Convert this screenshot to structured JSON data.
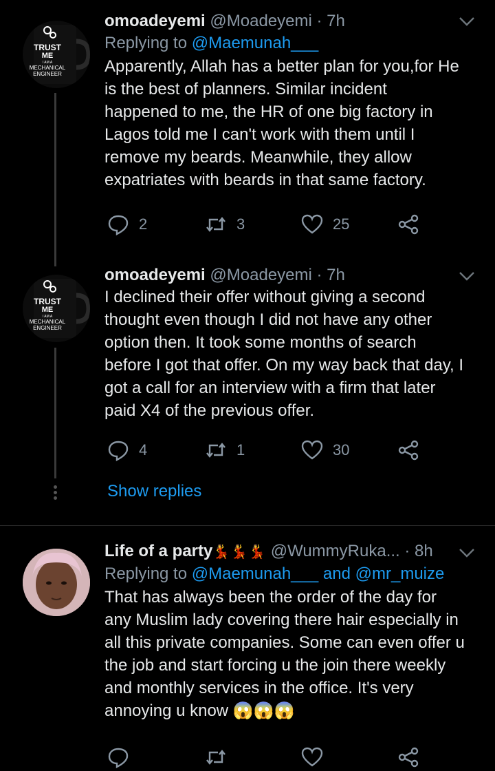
{
  "tweets": [
    {
      "display_name": "omoadeyemi",
      "handle": "@Moadeyemi",
      "time": "· 7h",
      "replying_prefix": "Replying to ",
      "replying_to": "@Maemunah___",
      "text": "Apparently, Allah has a better plan for you,for He\nis the best of planners. Similar incident\nhappened to me, the HR of one big factory in\nLagos told me I can't work with them until I\nremove my beards. Meanwhile, they allow\nexpatriates with beards in that same factory.",
      "replies": "2",
      "retweets": "3",
      "likes": "25",
      "avatar": {
        "line1": "TRUST",
        "line2": "ME",
        "line3": "I AM A",
        "line4": "MECHANICAL",
        "line5": "ENGINEER"
      }
    },
    {
      "display_name": "omoadeyemi",
      "handle": "@Moadeyemi",
      "time": "· 7h",
      "text": "I declined their offer without giving a second\nthought even though I did not have any other\noption then. It took some months of search\nbefore I got that offer. On my way back that day, I\ngot a call for an interview with a firm that later\npaid X4 of the previous offer.",
      "replies": "4",
      "retweets": "1",
      "likes": "30",
      "avatar": {
        "line1": "TRUST",
        "line2": "ME",
        "line3": "I AM A",
        "line4": "MECHANICAL",
        "line5": "ENGINEER"
      }
    },
    {
      "display_name": "Life of a party",
      "name_emoji": "💃💃💃",
      "handle": "@WummyRuka...",
      "time": "· 8h",
      "replying_prefix": "Replying to ",
      "replying_to": "@Maemunah___",
      "replying_and": " and ",
      "replying_to_2": "@mr_muize",
      "text": "That has always been the order of the day for\nany Muslim lady covering there hair especially in\nall this private companies. Some can even offer u\nthe job and start forcing u the join there weekly\nand monthly services in the office. It's very\nannoying u know",
      "text_emoji": "😱😱😱"
    }
  ],
  "show_replies": "Show replies",
  "colors": {
    "accent": "#1d9bf0",
    "background": "#000000",
    "muted": "#8b98a5"
  }
}
